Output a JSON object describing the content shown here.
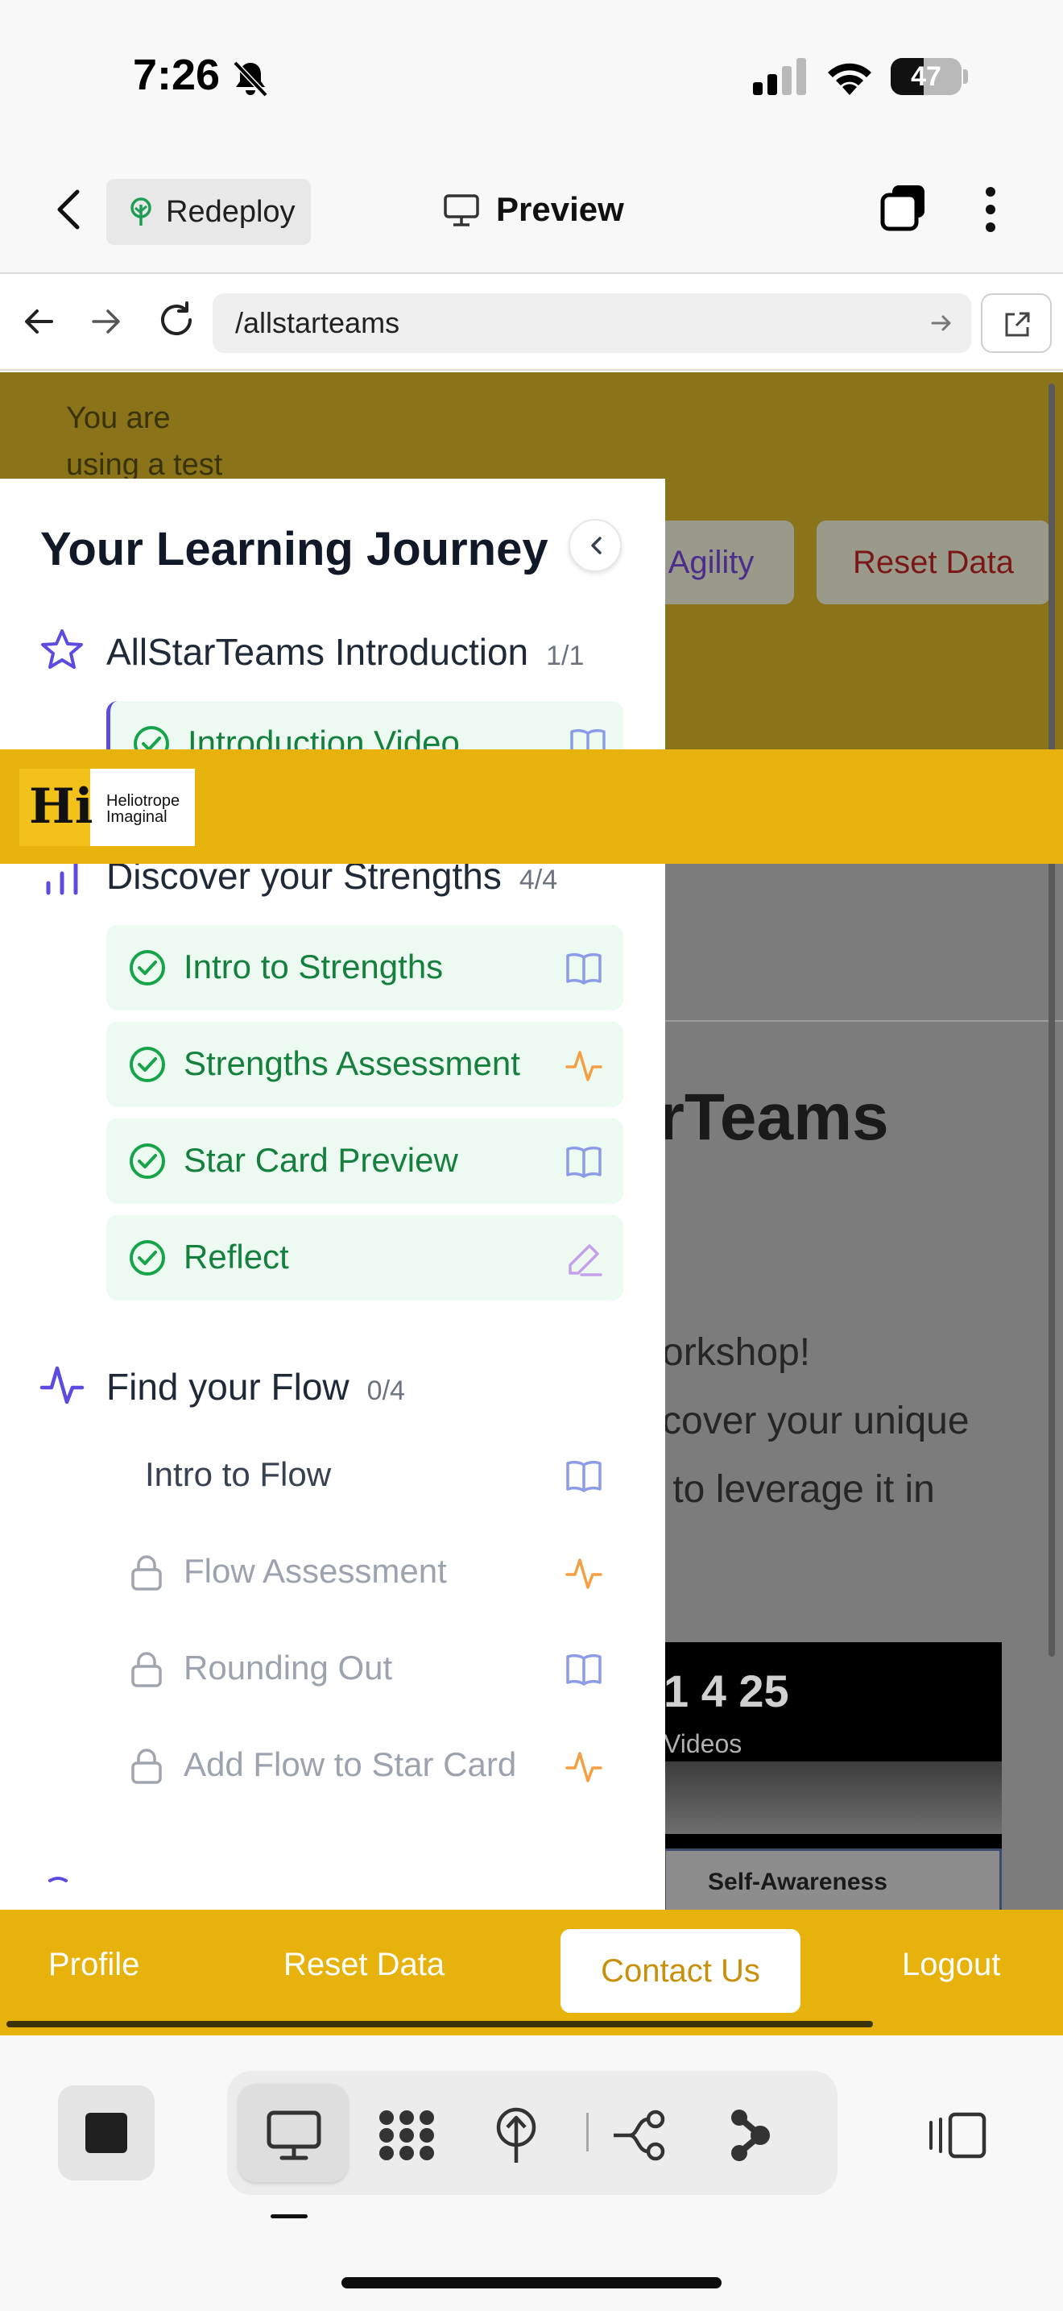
{
  "status_bar": {
    "time": "7:26",
    "battery": "47",
    "battery_level": 0.47
  },
  "app_header": {
    "redeploy_label": "Redeploy",
    "title": "Preview"
  },
  "url_bar": {
    "url": "/allstarteams"
  },
  "web": {
    "banner_text": [
      "You are",
      "using a test"
    ],
    "agility_button": "Agility",
    "reset_button": "Reset Data",
    "heading_fragment": "rTeams",
    "paragraph": [
      "orkshop!",
      "cover your unique",
      " to leverage it in"
    ],
    "video_numbers": "1 4 25",
    "video_sub": "Videos",
    "video_card_label": "Self-Awareness"
  },
  "sidebar": {
    "title": "Your Learning Journey",
    "sections": [
      {
        "title": "AllStarTeams Introduction",
        "count": "1/1",
        "items": [
          {
            "label": "Introduction Video",
            "state": "done",
            "type_icon": "book-icon"
          }
        ]
      },
      {
        "title": "Discover your Strengths",
        "count": "4/4",
        "items": [
          {
            "label": "Intro to Strengths",
            "state": "done",
            "type_icon": "book-icon"
          },
          {
            "label": "Strengths Assessment",
            "state": "done",
            "type_icon": "activity-icon"
          },
          {
            "label": "Star Card Preview",
            "state": "done",
            "type_icon": "book-icon"
          },
          {
            "label": "Reflect",
            "state": "done",
            "type_icon": "pencil-icon"
          }
        ]
      },
      {
        "title": "Find your Flow",
        "count": "0/4",
        "items": [
          {
            "label": "Intro to Flow",
            "state": "open",
            "type_icon": "book-icon"
          },
          {
            "label": "Flow Assessment",
            "state": "locked",
            "type_icon": "activity-icon"
          },
          {
            "label": "Rounding Out",
            "state": "locked",
            "type_icon": "book-icon"
          },
          {
            "label": "Add Flow to Star Card",
            "state": "locked",
            "type_icon": "activity-icon"
          }
        ]
      }
    ]
  },
  "logo": {
    "mark": "Hi",
    "line1": "Heliotrope",
    "line2": "Imaginal"
  },
  "footer": {
    "profile": "Profile",
    "reset": "Reset Data",
    "contact": "Contact Us",
    "logout": "Logout"
  },
  "colors": {
    "brand_yellow": "#e8b20c",
    "done_green": "#15803d",
    "accent_purple": "#5b4be0",
    "activity_orange": "#f59e42"
  }
}
